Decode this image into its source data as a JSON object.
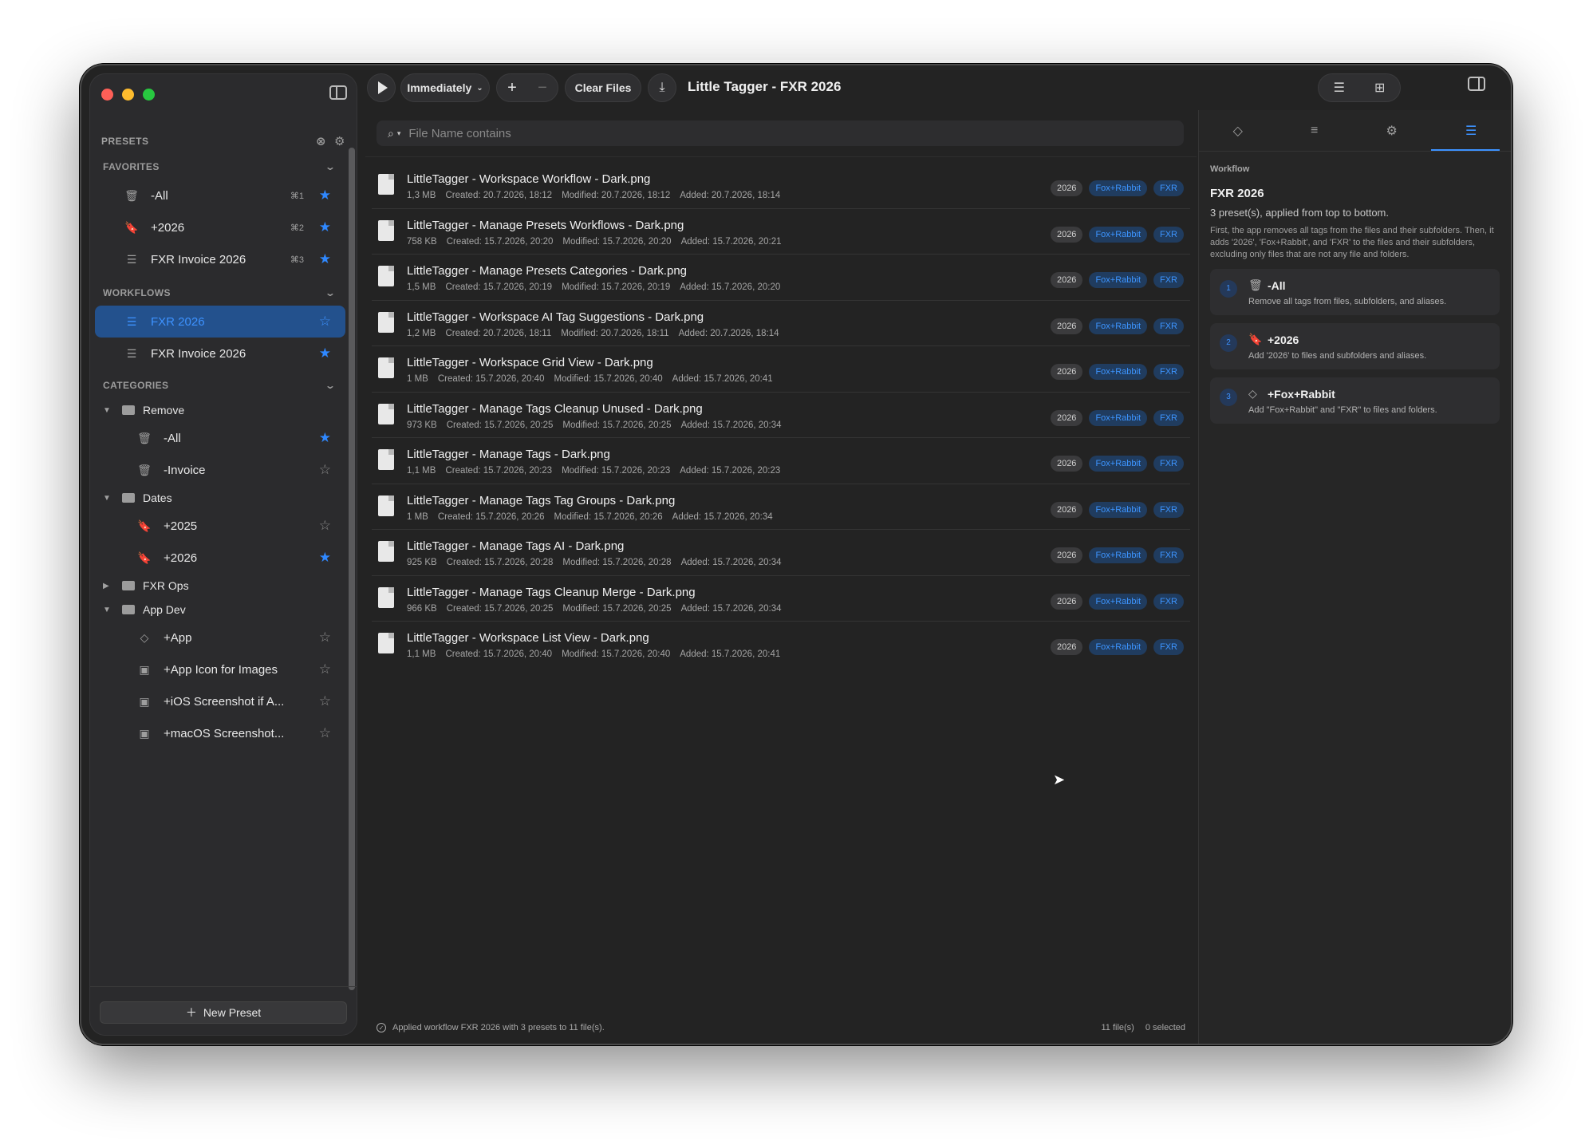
{
  "window_title": "Little Tagger - FXR 2026",
  "toolbar": {
    "timing_label": "Immediately",
    "clear_label": "Clear Files"
  },
  "sidebar": {
    "presets_header": "PRESETS",
    "favorites_header": "FAVORITES",
    "favorites": [
      {
        "label": "-All",
        "shortcut": "⌘1",
        "icon": "trash-icon",
        "starred": true
      },
      {
        "label": "+2026",
        "shortcut": "⌘2",
        "icon": "bookmark-icon",
        "starred": true
      },
      {
        "label": "FXR Invoice 2026",
        "shortcut": "⌘3",
        "icon": "workflow-icon",
        "starred": true
      }
    ],
    "workflows_header": "WORKFLOWS",
    "workflows": [
      {
        "label": "FXR 2026",
        "selected": true,
        "starred": false
      },
      {
        "label": "FXR Invoice 2026",
        "selected": false,
        "starred": true
      }
    ],
    "categories_header": "CATEGORIES",
    "categories": [
      {
        "name": "Remove",
        "expanded": true,
        "items": [
          {
            "label": "-All",
            "icon": "trash-icon",
            "starred": true
          },
          {
            "label": "-Invoice",
            "icon": "trash-icon",
            "starred": false
          }
        ]
      },
      {
        "name": "Dates",
        "expanded": true,
        "items": [
          {
            "label": "+2025",
            "icon": "bookmark-icon",
            "starred": false
          },
          {
            "label": "+2026",
            "icon": "bookmark-icon",
            "starred": true
          }
        ]
      },
      {
        "name": "FXR Ops",
        "expanded": false,
        "items": []
      },
      {
        "name": "App Dev",
        "expanded": true,
        "items": [
          {
            "label": "+App",
            "icon": "tag-icon",
            "starred": false
          },
          {
            "label": "+App Icon for Images",
            "icon": "image-icon",
            "starred": false
          },
          {
            "label": "+iOS Screenshot if A...",
            "icon": "image-icon",
            "starred": false
          },
          {
            "label": "+macOS Screenshot...",
            "icon": "image-icon",
            "starred": false
          }
        ]
      }
    ],
    "new_preset_label": "New Preset"
  },
  "search": {
    "placeholder": "File Name contains"
  },
  "files": [
    {
      "name": "LittleTagger - Workspace Workflow - Dark.png",
      "size": "1,3 MB",
      "created": "Created: 20.7.2026, 18:12",
      "modified": "Modified: 20.7.2026, 18:12",
      "added": "Added: 20.7.2026, 18:14"
    },
    {
      "name": "LittleTagger - Manage Presets Workflows - Dark.png",
      "size": "758 KB",
      "created": "Created: 15.7.2026, 20:20",
      "modified": "Modified: 15.7.2026, 20:20",
      "added": "Added: 15.7.2026, 20:21"
    },
    {
      "name": "LittleTagger - Manage Presets Categories - Dark.png",
      "size": "1,5 MB",
      "created": "Created: 15.7.2026, 20:19",
      "modified": "Modified: 15.7.2026, 20:19",
      "added": "Added: 15.7.2026, 20:20"
    },
    {
      "name": "LittleTagger - Workspace AI Tag Suggestions - Dark.png",
      "size": "1,2 MB",
      "created": "Created: 20.7.2026, 18:11",
      "modified": "Modified: 20.7.2026, 18:11",
      "added": "Added: 20.7.2026, 18:14"
    },
    {
      "name": "LittleTagger - Workspace Grid View - Dark.png",
      "size": "1 MB",
      "created": "Created: 15.7.2026, 20:40",
      "modified": "Modified: 15.7.2026, 20:40",
      "added": "Added: 15.7.2026, 20:41"
    },
    {
      "name": "LittleTagger - Manage Tags Cleanup Unused - Dark.png",
      "size": "973 KB",
      "created": "Created: 15.7.2026, 20:25",
      "modified": "Modified: 15.7.2026, 20:25",
      "added": "Added: 15.7.2026, 20:34"
    },
    {
      "name": "LittleTagger - Manage Tags - Dark.png",
      "size": "1,1 MB",
      "created": "Created: 15.7.2026, 20:23",
      "modified": "Modified: 15.7.2026, 20:23",
      "added": "Added: 15.7.2026, 20:23"
    },
    {
      "name": "LittleTagger - Manage Tags Tag Groups - Dark.png",
      "size": "1 MB",
      "created": "Created: 15.7.2026, 20:26",
      "modified": "Modified: 15.7.2026, 20:26",
      "added": "Added: 15.7.2026, 20:34"
    },
    {
      "name": "LittleTagger - Manage Tags AI - Dark.png",
      "size": "925 KB",
      "created": "Created: 15.7.2026, 20:28",
      "modified": "Modified: 15.7.2026, 20:28",
      "added": "Added: 15.7.2026, 20:34"
    },
    {
      "name": "LittleTagger - Manage Tags Cleanup Merge - Dark.png",
      "size": "966 KB",
      "created": "Created: 15.7.2026, 20:25",
      "modified": "Modified: 15.7.2026, 20:25",
      "added": "Added: 15.7.2026, 20:34"
    },
    {
      "name": "LittleTagger - Workspace List View - Dark.png",
      "size": "1,1 MB",
      "created": "Created: 15.7.2026, 20:40",
      "modified": "Modified: 15.7.2026, 20:40",
      "added": "Added: 15.7.2026, 20:41"
    }
  ],
  "file_tags": [
    "2026",
    "Fox+Rabbit",
    "FXR"
  ],
  "status": {
    "message": "Applied workflow FXR 2026 with 3 presets to 11 file(s).",
    "file_count": "11 file(s)",
    "selected_count": "0 selected"
  },
  "inspector": {
    "kicker": "Workflow",
    "title": "FXR 2026",
    "subtitle": "3 preset(s), applied from top to bottom.",
    "description": "First, the app removes all tags from the files and their subfolders. Then, it adds '2026', 'Fox+Rabbit', and 'FXR' to the files and their subfolders, excluding only files that are not any file and folders.",
    "steps": [
      {
        "num": "1",
        "icon": "trash-icon",
        "name": "-All",
        "desc": "Remove all tags from files, subfolders, and aliases."
      },
      {
        "num": "2",
        "icon": "bookmark-icon",
        "name": "+2026",
        "desc": "Add '2026' to files and subfolders and aliases."
      },
      {
        "num": "3",
        "icon": "tag-icon",
        "name": "+Fox+Rabbit",
        "desc": "Add \"Fox+Rabbit\" and \"FXR\" to files and folders."
      }
    ]
  },
  "colors": {
    "accent": "#3d92ff",
    "selected_bg": "#23518d",
    "window_bg": "#232323"
  }
}
